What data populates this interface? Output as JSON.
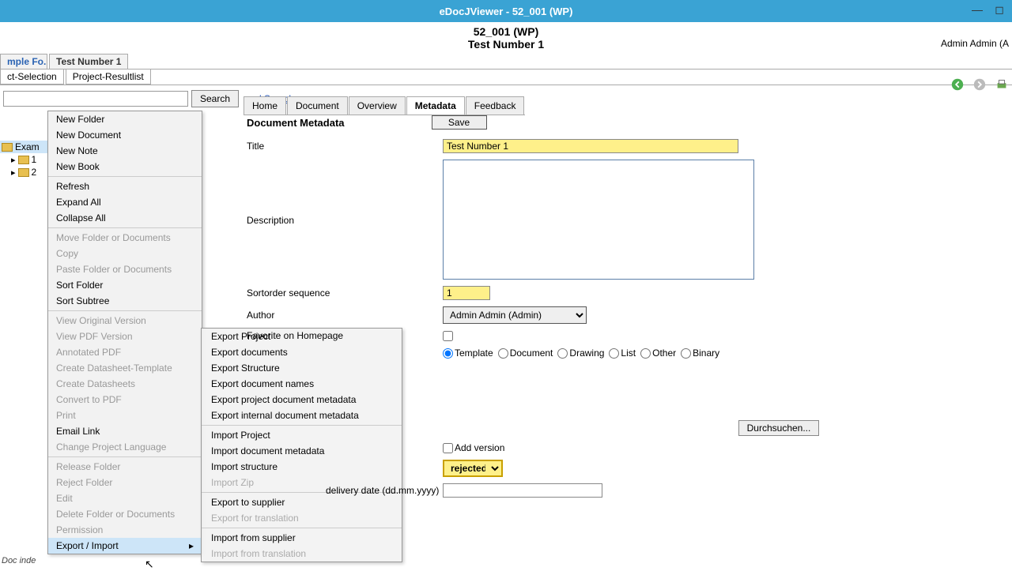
{
  "window": {
    "title": "eDocJViewer - 52_001 (WP)"
  },
  "subtitle": {
    "line1": "52_001 (WP)",
    "line2": "Test Number 1"
  },
  "user": "Admin Admin (A",
  "topTabs": {
    "left": "mple Fo...",
    "right": "Test Number 1"
  },
  "subTabs": {
    "left": "ct-Selection",
    "right": "Project-Resultlist"
  },
  "search": {
    "button": "Search",
    "extended": "d Search"
  },
  "tree": {
    "root": "Exam",
    "n1": "1",
    "n2": "2"
  },
  "context": {
    "newFolder": "New Folder",
    "newDocument": "New Document",
    "newNote": "New Note",
    "newBook": "New Book",
    "refresh": "Refresh",
    "expandAll": "Expand All",
    "collapseAll": "Collapse All",
    "moveFolder": "Move Folder or Documents",
    "copy": "Copy",
    "pasteFolder": "Paste Folder or Documents",
    "sortFolder": "Sort Folder",
    "sortSubtree": "Sort Subtree",
    "viewOriginal": "View Original Version",
    "viewPDF": "View PDF Version",
    "annotatedPDF": "Annotated PDF",
    "createDST": "Create Datasheet-Template",
    "createDS": "Create Datasheets",
    "convertPDF": "Convert to PDF",
    "print": "Print",
    "emailLink": "Email Link",
    "changeLang": "Change Project Language",
    "releaseFolder": "Release Folder",
    "rejectFolder": "Reject Folder",
    "edit": "Edit",
    "deleteFolder": "Delete Folder or Documents",
    "permission": "Permission",
    "exportImport": "Export / Import"
  },
  "submenu": {
    "exportProject": "Export Project",
    "exportDocs": "Export documents",
    "exportStructure": "Export Structure",
    "exportDocNames": "Export document names",
    "exportPDM": "Export project document metadata",
    "exportIDM": "Export internal document metadata",
    "importProject": "Import Project",
    "importDM": "Import document metadata",
    "importStructure": "Import structure",
    "importZip": "Import Zip",
    "exportSupplier": "Export to supplier",
    "exportTrans": "Export for translation",
    "importSupplier": "Import from supplier",
    "importTrans": "Import from translation"
  },
  "contentTabs": {
    "home": "Home",
    "document": "Document",
    "overview": "Overview",
    "metadata": "Metadata",
    "feedback": "Feedback"
  },
  "panel": {
    "title": "Document Metadata",
    "save": "Save"
  },
  "form": {
    "titleLabel": "Title",
    "titleValue": "Test Number 1",
    "descLabel": "Description",
    "descValue": "",
    "sortLabel": "Sortorder sequence",
    "sortValue": "1",
    "authorLabel": "Author",
    "authorValue": "Admin Admin (Admin)",
    "favLabel": "Favorite on Homepage",
    "radios": {
      "template": "Template",
      "document": "Document",
      "drawing": "Drawing",
      "list": "List",
      "other": "Other",
      "binary": "Binary"
    },
    "browse": "Durchsuchen...",
    "addVersion": "Add version",
    "stateValue": "rejected",
    "dateLabel": "delivery date (dd.mm.yyyy)"
  },
  "footer": {
    "docindex": "Doc inde"
  }
}
